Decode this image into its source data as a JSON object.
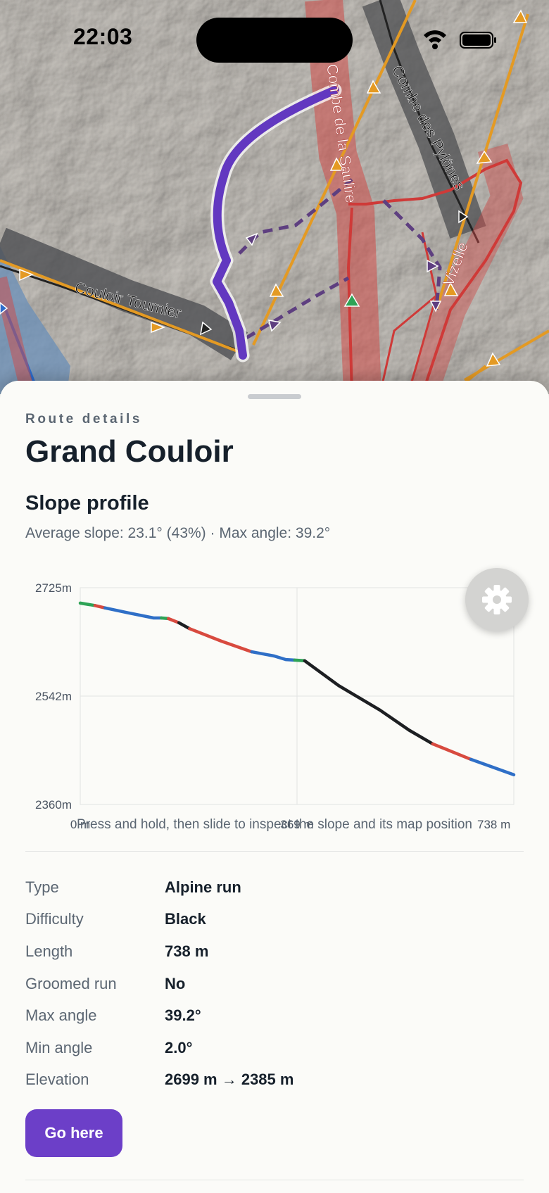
{
  "status_bar": {
    "time": "22:03"
  },
  "map": {
    "labels": {
      "run1": "Combe de la Saulire",
      "run2": "Combe des Pylônes",
      "run3": "Couloir Tournier",
      "run4": "Vizelle"
    }
  },
  "sheet": {
    "eyebrow": "Route details",
    "title": "Grand Couloir",
    "section_title": "Slope profile",
    "stats": "Average slope: 23.1° (43%) · Max angle: 39.2°",
    "chart_hint": "Press and hold, then slide to inspect the slope and its map position",
    "settings_icon": "gear-icon",
    "details": [
      {
        "label": "Type",
        "value": "Alpine run"
      },
      {
        "label": "Difficulty",
        "value": "Black"
      },
      {
        "label": "Length",
        "value": "738 m"
      },
      {
        "label": "Groomed run",
        "value": "No"
      },
      {
        "label": "Max angle",
        "value": "39.2°"
      },
      {
        "label": "Min angle",
        "value": "2.0°"
      },
      {
        "label": "Elevation",
        "value": "2699 m → 2385 m"
      }
    ],
    "go_button": "Go here"
  },
  "chart_data": {
    "type": "line",
    "title": "Slope profile",
    "xlabel": "",
    "ylabel": "",
    "x_tick_labels": [
      "0 m",
      "369 m",
      "738 m"
    ],
    "y_tick_labels": [
      "2725m",
      "2542m",
      "2360m"
    ],
    "xlim": [
      0,
      738
    ],
    "ylim": [
      2360,
      2725
    ],
    "grid": true,
    "colors": {
      "green": "#2ea356",
      "blue": "#2f6fc7",
      "red": "#d84a3f",
      "black": "#1d1f22"
    },
    "segments": [
      {
        "color": "green",
        "points": [
          [
            0,
            2699
          ],
          [
            25,
            2695
          ]
        ]
      },
      {
        "color": "red",
        "points": [
          [
            25,
            2695
          ],
          [
            42,
            2691
          ]
        ]
      },
      {
        "color": "blue",
        "points": [
          [
            42,
            2691
          ],
          [
            80,
            2683
          ],
          [
            125,
            2674
          ],
          [
            138,
            2674
          ]
        ]
      },
      {
        "color": "green",
        "points": [
          [
            138,
            2674
          ],
          [
            150,
            2673
          ]
        ]
      },
      {
        "color": "red",
        "points": [
          [
            150,
            2673
          ],
          [
            168,
            2666
          ]
        ]
      },
      {
        "color": "black",
        "points": [
          [
            168,
            2666
          ],
          [
            186,
            2656
          ]
        ]
      },
      {
        "color": "red",
        "points": [
          [
            186,
            2656
          ],
          [
            240,
            2635
          ],
          [
            292,
            2617
          ]
        ]
      },
      {
        "color": "blue",
        "points": [
          [
            292,
            2617
          ],
          [
            330,
            2610
          ],
          [
            350,
            2604
          ],
          [
            365,
            2603
          ]
        ]
      },
      {
        "color": "green",
        "points": [
          [
            365,
            2603
          ],
          [
            382,
            2602
          ]
        ]
      },
      {
        "color": "black",
        "points": [
          [
            382,
            2602
          ],
          [
            440,
            2560
          ],
          [
            510,
            2519
          ],
          [
            560,
            2485
          ],
          [
            600,
            2462
          ]
        ]
      },
      {
        "color": "red",
        "points": [
          [
            600,
            2462
          ],
          [
            665,
            2436
          ]
        ]
      },
      {
        "color": "blue",
        "points": [
          [
            665,
            2436
          ],
          [
            738,
            2410
          ]
        ]
      }
    ]
  }
}
